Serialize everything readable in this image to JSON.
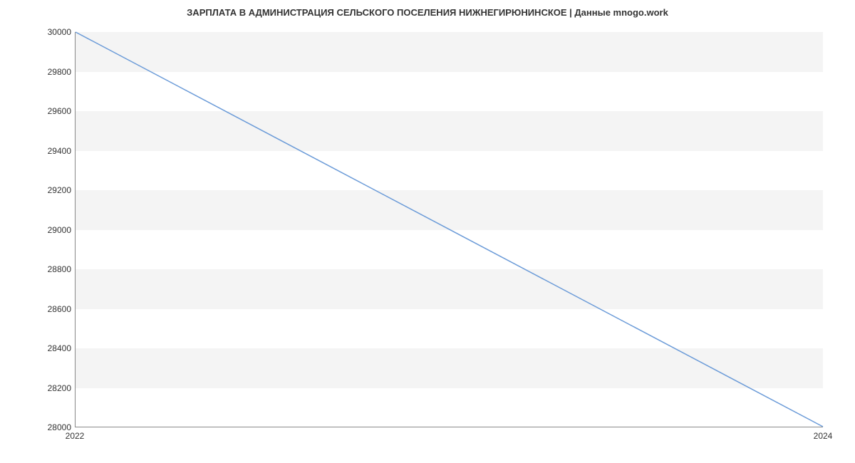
{
  "chart_data": {
    "type": "line",
    "title": "ЗАРПЛАТА В АДМИНИСТРАЦИЯ СЕЛЬСКОГО ПОСЕЛЕНИЯ НИЖНЕГИРЮНИНСКОЕ | Данные mnogo.work",
    "x": [
      2022,
      2024
    ],
    "values": [
      30000,
      28000
    ],
    "xlabel": "",
    "ylabel": "",
    "xlim": [
      2022,
      2024
    ],
    "ylim": [
      28000,
      30000
    ],
    "x_ticks": [
      2022,
      2024
    ],
    "y_ticks": [
      28000,
      28200,
      28400,
      28600,
      28800,
      29000,
      29200,
      29400,
      29600,
      29800,
      30000
    ],
    "line_color": "#6b9bd8"
  }
}
